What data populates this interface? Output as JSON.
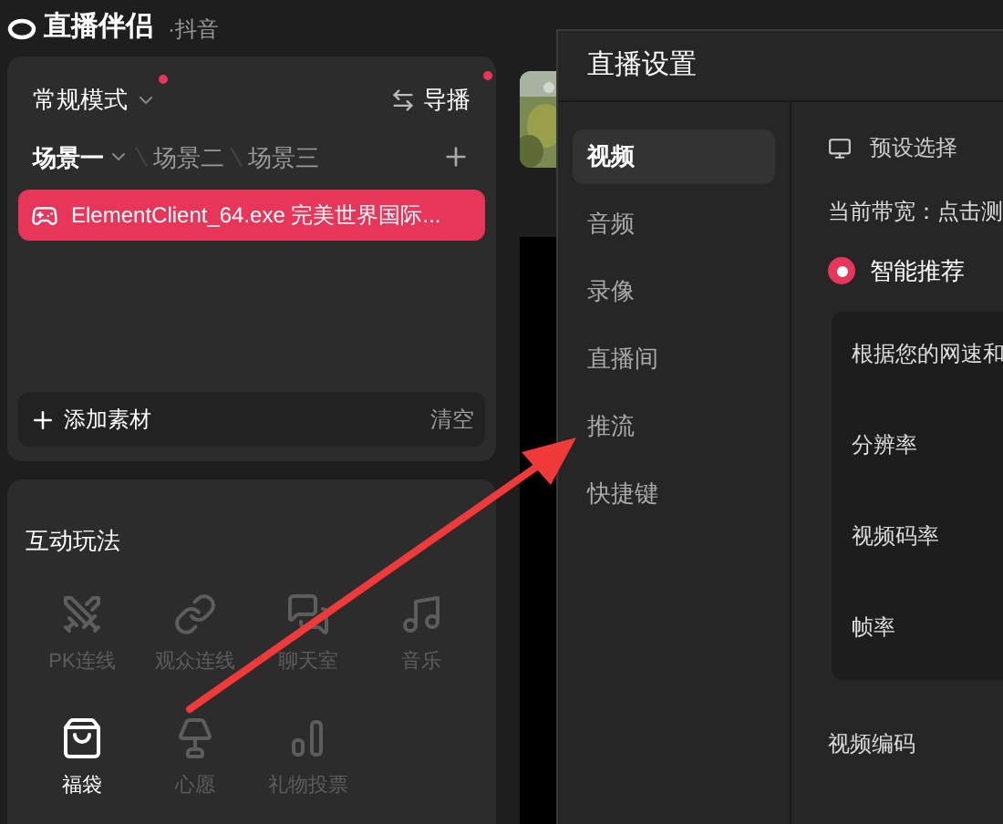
{
  "app": {
    "title": "直播伴侣",
    "platform": "·抖音"
  },
  "scene_panel": {
    "mode": "常规模式",
    "mode_alert": true,
    "director": "导播",
    "director_alert": true,
    "scenes": [
      {
        "label": "场景一",
        "selected": true
      },
      {
        "label": "场景二",
        "selected": false
      },
      {
        "label": "场景三",
        "selected": false
      }
    ],
    "sources": [
      {
        "label": "ElementClient_64.exe 完美世界国际...",
        "selected": true
      }
    ],
    "add_label": "添加素材",
    "clear_label": "清空"
  },
  "interactive_panel": {
    "title": "互动玩法",
    "items": [
      {
        "kind": "pk",
        "label": "PK连线",
        "disabled": true
      },
      {
        "kind": "link",
        "label": "观众连线",
        "disabled": true
      },
      {
        "kind": "chat",
        "label": "聊天室",
        "disabled": true
      },
      {
        "kind": "music",
        "label": "音乐",
        "disabled": true
      },
      {
        "kind": "bag",
        "label": "福袋",
        "disabled": false
      },
      {
        "kind": "lamp",
        "label": "心愿",
        "disabled": true
      },
      {
        "kind": "vote",
        "label": "礼物投票",
        "disabled": true
      }
    ]
  },
  "dialog": {
    "title": "直播设置",
    "nav": [
      {
        "label": "视频",
        "selected": true
      },
      {
        "label": "音频",
        "selected": false
      },
      {
        "label": "录像",
        "selected": false
      },
      {
        "label": "直播间",
        "selected": false
      },
      {
        "label": "推流",
        "selected": false
      },
      {
        "label": "快捷键",
        "selected": false
      }
    ],
    "preset_label": "预设选择",
    "bandwidth": "当前带宽：点击测",
    "smart": {
      "label": "智能推荐",
      "selected": true
    },
    "card": {
      "hint": "根据您的网速和",
      "fields": [
        "分辨率",
        "视频码率",
        "帧率"
      ]
    },
    "codec_label": "视频编码"
  }
}
